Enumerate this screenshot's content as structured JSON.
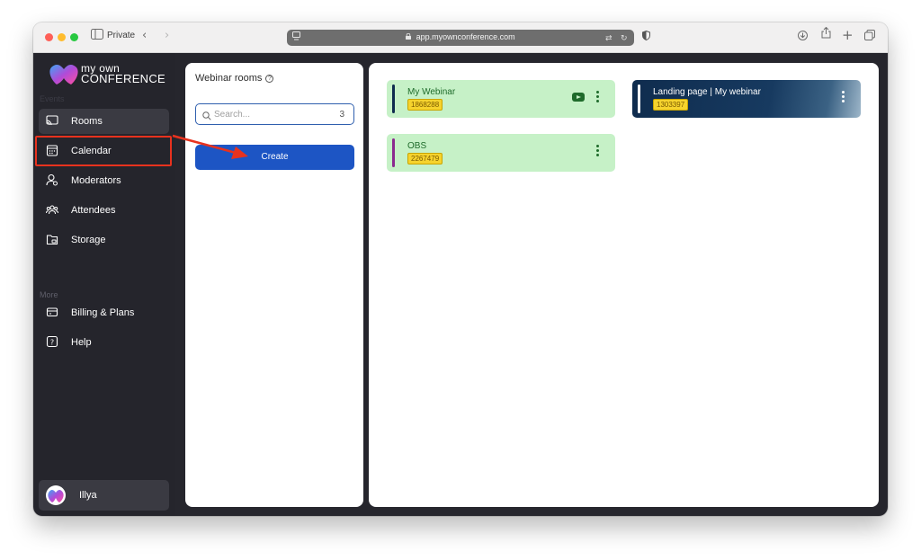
{
  "browser": {
    "private_label": "Private",
    "url": "app.myownconference.com"
  },
  "sidebar": {
    "logo": {
      "line1": "my own",
      "line2": "CONFERENCE"
    },
    "section_top": "Events",
    "section_more": "More",
    "items": [
      {
        "label": "Rooms",
        "icon": "cast-icon",
        "active": true
      },
      {
        "label": "Calendar",
        "icon": "calendar-icon"
      },
      {
        "label": "Moderators",
        "icon": "moderator-icon"
      },
      {
        "label": "Attendees",
        "icon": "attendees-icon"
      },
      {
        "label": "Storage",
        "icon": "storage-icon"
      }
    ],
    "more_items": [
      {
        "label": "Billing & Plans",
        "icon": "card-icon"
      },
      {
        "label": "Help",
        "icon": "help-icon"
      }
    ],
    "user": {
      "name": "Illya"
    }
  },
  "rooms_panel": {
    "title": "Webinar rooms",
    "search": {
      "placeholder": "Search...",
      "count": "3"
    },
    "create_label": "Create"
  },
  "rooms": [
    {
      "name": "My Webinar",
      "id": "1868288",
      "style": "green",
      "bar_color": "#0f2c4e",
      "has_youtube": true
    },
    {
      "name": "Landing page | My webinar",
      "id": "1303397",
      "style": "dark",
      "bar_color": "#ffffff",
      "has_youtube": false
    },
    {
      "name": "OBS",
      "id": "2267479",
      "style": "green",
      "bar_color": "#8b2a8f",
      "has_youtube": false
    }
  ],
  "colors": {
    "accent": "#1d55c4",
    "highlight": "#e8321e",
    "room_green": "#c6f1c7",
    "id_badge": "#f6d32d"
  }
}
